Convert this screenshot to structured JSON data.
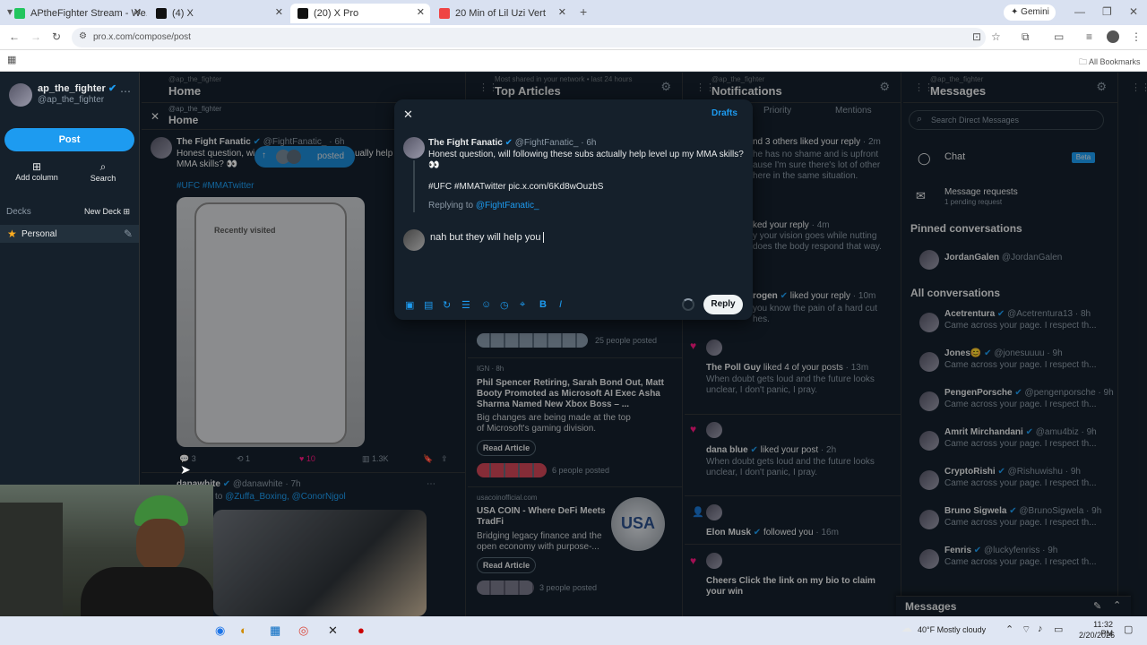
{
  "browser": {
    "tabs": [
      {
        "title": "APtheFighter Stream - We...",
        "color": "#22c55e"
      },
      {
        "title": "(4) X",
        "color": "#111111"
      },
      {
        "title": "(20) X Pro",
        "color": "#111111"
      },
      {
        "title": "20 Min of Lil Uzi Vert",
        "color": "#ef4444"
      }
    ],
    "gemini_label": "Gemini",
    "url": "pro.x.com/compose/post",
    "all_bookmarks": "All Bookmarks"
  },
  "sidebar": {
    "display_name": "ap_the_fighter",
    "handle": "@ap_the_fighter",
    "post_label": "Post",
    "add_column_label": "Add column",
    "search_label": "Search",
    "decks_label": "Decks",
    "new_deck_label": "New Deck",
    "deck_name": "Personal"
  },
  "home_column": {
    "sub": "@ap_the_fighter",
    "title": "Home",
    "inner_sub": "@ap_the_fighter",
    "inner_title": "Home",
    "tweet": {
      "author": "The Fight Fanatic",
      "handle": "@FightFanatic_",
      "time": "6h",
      "text_1": "Honest question, wi",
      "text_1b": "ually help le",
      "text_2": "MMA skills? 👀",
      "hashtags": "#UFC #MMATwitter",
      "posted_badge": "posted",
      "phone_title": "Recently visited",
      "replies": "3",
      "retweets": "1",
      "likes": "10",
      "views": "1.3K"
    },
    "tweet2": {
      "author": "danawhite",
      "handle": "@danawhite",
      "time": "7h",
      "reply_to_prefix": "to",
      "reply_to": "@Zuffa_Boxing, @ConorNjgol"
    }
  },
  "top_articles": {
    "sub": "Most shared in your network • last 24 hours",
    "title": "Top Articles",
    "posted_count_1": "25 people posted",
    "article_2_source": "IGN · 8h",
    "article_2_title": "Phil Spencer Retiring, Sarah Bond Out, Matt Booty Promoted as Microsoft AI Exec Asha Sharma Named New Xbox Boss – ...",
    "article_2_desc": "Big changes are being made at the top of Microsoft's gaming division.",
    "read_article": "Read Article",
    "posted_count_2": "6 people posted",
    "article_3_source": "usacoinofficial.com",
    "article_3_title": "USA COIN - Where DeFi Meets TradFi",
    "article_3_desc": "Bridging legacy finance and the open economy with purpose-...",
    "coin_text": "USA",
    "posted_count_3": "3 people posted"
  },
  "notifications": {
    "sub": "@ap_the_fighter",
    "title": "Notifications",
    "tab_priority": "Priority",
    "tab_mentions": "Mentions",
    "n1": "nd 3 others liked your reply",
    "n1_time": "2m",
    "n1_pv1": "he has no shame and is upfront",
    "n1_pv2": "ause I'm sure there's lot of other",
    "n1_pv3": "here in the same situation.",
    "n2": "ked your reply",
    "n2_time": "4m",
    "n2_pv1": "y your vision goes while nutting",
    "n2_pv2": "does the body respond that way.",
    "n3_name": "rogen",
    "n3_action": "liked your reply",
    "n3_time": "10m",
    "n3_pv1": "you know the pain of a hard cut",
    "n3_pv2": "hes.",
    "n4_name": "The Poll Guy",
    "n4_action": "liked 4 of your posts",
    "n4_time": "13m",
    "n4_pv1": "When doubt gets loud and the future looks",
    "n4_pv2": "unclear, I don't panic, I pray.",
    "n5_name": "dana blue",
    "n5_action": "liked your post",
    "n5_time": "2h",
    "n5_pv1": "When doubt gets loud and the future looks",
    "n5_pv2": "unclear, I don't panic, I pray.",
    "n6_name": "Elon Musk",
    "n6_action": "followed you",
    "n6_time": "16m",
    "n7_text": "Cheers Click the link on my bio to claim your win"
  },
  "messages": {
    "sub": "@ap_the_fighter",
    "title": "Messages",
    "search_placeholder": "Search Direct Messages",
    "chat_label": "Chat",
    "beta_badge": "Beta",
    "requests_label": "Message requests",
    "requests_sub": "1 pending request",
    "pinned_heading": "Pinned conversations",
    "pinned": {
      "name": "JordanGalen",
      "handle": "@JordanGalen"
    },
    "all_heading": "All conversations",
    "conversations": [
      {
        "name": "Acetrentura",
        "handle": "@Acetrentura13",
        "time": "8h",
        "preview": "Came across your page. I respect th..."
      },
      {
        "name": "Jones😊",
        "handle": "@jonesuuuu",
        "time": "9h",
        "preview": "Came across your page. I respect th..."
      },
      {
        "name": "PengenPorsche",
        "handle": "@pengenporsche",
        "time": "9h",
        "preview": "Came across your page. I respect th..."
      },
      {
        "name": "Amrit Mirchandani",
        "handle": "@amu4biz",
        "time": "9h",
        "preview": "Came across your page. I respect th..."
      },
      {
        "name": "CryptoRishi",
        "handle": "@Rishuwishu",
        "time": "9h",
        "preview": "Came across your page. I respect th..."
      },
      {
        "name": "Bruno Sigwela",
        "handle": "@BrunoSigwela",
        "time": "9h",
        "preview": "Came across your page. I respect th..."
      },
      {
        "name": "Fenris",
        "handle": "@luckyfenriss",
        "time": "9h",
        "preview": "Came across your page. I respect th..."
      }
    ],
    "drawer_label": "Messages"
  },
  "compose": {
    "drafts_label": "Drafts",
    "author": "The Fight Fanatic",
    "handle": "@FightFanatic_",
    "time": "6h",
    "line_1": "Honest question, will following these subs actually help level up my MMA skills?",
    "line_2": "👀",
    "line_3": "#UFC #MMATwitter pic.x.com/6Kd8wOuzbS",
    "replying_prefix": "Replying to",
    "replying_to": "@FightFanatic_",
    "reply_text": "nah but they will help you",
    "reply_button": "Reply"
  },
  "taskbar": {
    "weather": "40°F  Mostly cloudy",
    "time": "11:32 PM",
    "date": "2/20/2026"
  },
  "colors": {
    "accent": "#1d9bf0",
    "bg": "#15202b",
    "like": "#f91880"
  }
}
